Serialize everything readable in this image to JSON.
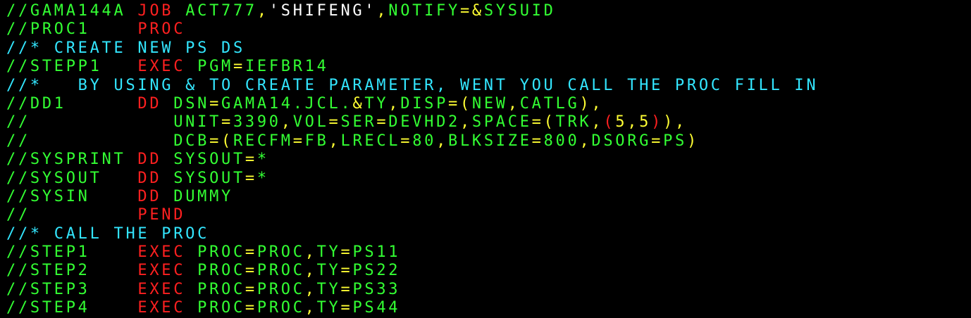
{
  "colors": {
    "background": "#000000",
    "green": "#33ff33",
    "red": "#ff2020",
    "yellow": "#ffff33",
    "cyan": "#33e6ff",
    "white": "#ffffff"
  },
  "lines": [
    [
      [
        "green",
        "//GAMA144A "
      ],
      [
        "red",
        "JOB "
      ],
      [
        "green",
        "ACT777"
      ],
      [
        "yellow",
        ","
      ],
      [
        "white",
        "'SHIFENG'"
      ],
      [
        "yellow",
        ","
      ],
      [
        "green",
        "NOTIFY"
      ],
      [
        "yellow",
        "="
      ],
      [
        "yellow",
        "&"
      ],
      [
        "green",
        "SYSUID"
      ]
    ],
    [
      [
        "green",
        "//PROC1    "
      ],
      [
        "red",
        "PROC"
      ]
    ],
    [
      [
        "cyan",
        "//* CREATE NEW PS DS"
      ]
    ],
    [
      [
        "green",
        "//STEPP1   "
      ],
      [
        "red",
        "EXEC "
      ],
      [
        "green",
        "PGM"
      ],
      [
        "yellow",
        "="
      ],
      [
        "green",
        "IEFBR14"
      ]
    ],
    [
      [
        "cyan",
        "//*   BY USING & TO CREATE PARAMETER, WENT YOU CALL THE PROC FILL IN"
      ]
    ],
    [
      [
        "green",
        "//DD1      "
      ],
      [
        "red",
        "DD "
      ],
      [
        "green",
        "DSN"
      ],
      [
        "yellow",
        "="
      ],
      [
        "green",
        "GAMA14.JCL."
      ],
      [
        "yellow",
        "&"
      ],
      [
        "green",
        "TY"
      ],
      [
        "yellow",
        ","
      ],
      [
        "green",
        "DISP"
      ],
      [
        "yellow",
        "=("
      ],
      [
        "green",
        "NEW"
      ],
      [
        "yellow",
        ","
      ],
      [
        "green",
        "CATLG"
      ],
      [
        "yellow",
        "),"
      ]
    ],
    [
      [
        "green",
        "//            "
      ],
      [
        "green",
        "UNIT"
      ],
      [
        "yellow",
        "="
      ],
      [
        "green",
        "3390"
      ],
      [
        "yellow",
        ","
      ],
      [
        "green",
        "VOL"
      ],
      [
        "yellow",
        "="
      ],
      [
        "green",
        "SER"
      ],
      [
        "yellow",
        "="
      ],
      [
        "green",
        "DEVHD2"
      ],
      [
        "yellow",
        ","
      ],
      [
        "green",
        "SPACE"
      ],
      [
        "yellow",
        "=("
      ],
      [
        "green",
        "TRK"
      ],
      [
        "yellow",
        ","
      ],
      [
        "red",
        "("
      ],
      [
        "yellow",
        "5,5"
      ],
      [
        "red",
        ")"
      ],
      [
        "yellow",
        "),"
      ]
    ],
    [
      [
        "green",
        "//            "
      ],
      [
        "green",
        "DCB"
      ],
      [
        "yellow",
        "=("
      ],
      [
        "green",
        "RECFM"
      ],
      [
        "yellow",
        "="
      ],
      [
        "green",
        "FB"
      ],
      [
        "yellow",
        ","
      ],
      [
        "green",
        "LRECL"
      ],
      [
        "yellow",
        "="
      ],
      [
        "green",
        "80"
      ],
      [
        "yellow",
        ","
      ],
      [
        "green",
        "BLKSIZE"
      ],
      [
        "yellow",
        "="
      ],
      [
        "green",
        "800"
      ],
      [
        "yellow",
        ","
      ],
      [
        "green",
        "DSORG"
      ],
      [
        "yellow",
        "="
      ],
      [
        "green",
        "PS"
      ],
      [
        "yellow",
        ")"
      ]
    ],
    [
      [
        "green",
        "//SYSPRINT "
      ],
      [
        "red",
        "DD "
      ],
      [
        "green",
        "SYSOUT"
      ],
      [
        "yellow",
        "="
      ],
      [
        "green",
        "*"
      ]
    ],
    [
      [
        "green",
        "//SYSOUT   "
      ],
      [
        "red",
        "DD "
      ],
      [
        "green",
        "SYSOUT"
      ],
      [
        "yellow",
        "="
      ],
      [
        "green",
        "*"
      ]
    ],
    [
      [
        "green",
        "//SYSIN    "
      ],
      [
        "red",
        "DD "
      ],
      [
        "green",
        "DUMMY"
      ]
    ],
    [
      [
        "green",
        "//         "
      ],
      [
        "red",
        "PEND"
      ]
    ],
    [
      [
        "cyan",
        "//* CALL THE PROC"
      ]
    ],
    [
      [
        "green",
        "//STEP1    "
      ],
      [
        "red",
        "EXEC "
      ],
      [
        "green",
        "PROC"
      ],
      [
        "yellow",
        "="
      ],
      [
        "green",
        "PROC"
      ],
      [
        "yellow",
        ","
      ],
      [
        "green",
        "TY"
      ],
      [
        "yellow",
        "="
      ],
      [
        "green",
        "PS11"
      ]
    ],
    [
      [
        "green",
        "//STEP2    "
      ],
      [
        "red",
        "EXEC "
      ],
      [
        "green",
        "PROC"
      ],
      [
        "yellow",
        "="
      ],
      [
        "green",
        "PROC"
      ],
      [
        "yellow",
        ","
      ],
      [
        "green",
        "TY"
      ],
      [
        "yellow",
        "="
      ],
      [
        "green",
        "PS22"
      ]
    ],
    [
      [
        "green",
        "//STEP3    "
      ],
      [
        "red",
        "EXEC "
      ],
      [
        "green",
        "PROC"
      ],
      [
        "yellow",
        "="
      ],
      [
        "green",
        "PROC"
      ],
      [
        "yellow",
        ","
      ],
      [
        "green",
        "TY"
      ],
      [
        "yellow",
        "="
      ],
      [
        "green",
        "PS33"
      ]
    ],
    [
      [
        "green",
        "//STEP4    "
      ],
      [
        "red",
        "EXEC "
      ],
      [
        "green",
        "PROC"
      ],
      [
        "yellow",
        "="
      ],
      [
        "green",
        "PROC"
      ],
      [
        "yellow",
        ","
      ],
      [
        "green",
        "TY"
      ],
      [
        "yellow",
        "="
      ],
      [
        "green",
        "PS44"
      ]
    ]
  ]
}
